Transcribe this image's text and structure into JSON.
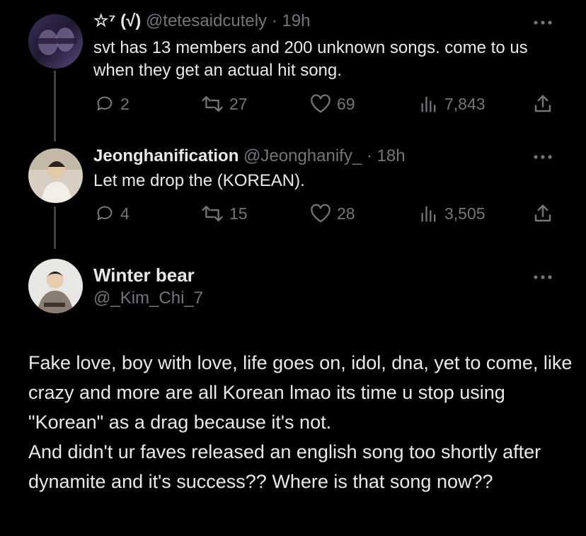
{
  "tweets": [
    {
      "badge": "☆⁷ (√)",
      "handle": "@tetesaidcutely",
      "time": "· 19h",
      "text": "svt has 13 members and 200 unknown songs. come to us when they get an actual hit song.",
      "replies": "2",
      "retweets": "27",
      "likes": "69",
      "views": "7,843"
    },
    {
      "name": "Jeonghanification",
      "handle": "@Jeonghanify_",
      "time": "· 18h",
      "text": "Let me drop the (KOREAN).",
      "replies": "4",
      "retweets": "15",
      "likes": "28",
      "views": "3,505"
    }
  ],
  "main_tweet": {
    "name": "Winter bear",
    "handle": "@_Kim_Chi_7",
    "text_p1": "Fake love, boy with love, life goes on, idol, dna, yet to come, like crazy and more are all Korean lmao its time u stop using \"Korean\" as a drag because it's not.",
    "text_p2": "And didn't ur faves released an english song too shortly after dynamite and it's success?? Where is that song now??"
  },
  "icons": [
    "reply-icon",
    "retweet-icon",
    "like-icon",
    "views-icon",
    "share-icon",
    "more-icon"
  ],
  "colors": {
    "background": "#000000",
    "text": "#e7e9ea",
    "muted": "#71767b",
    "thread_line": "#3e4144"
  }
}
